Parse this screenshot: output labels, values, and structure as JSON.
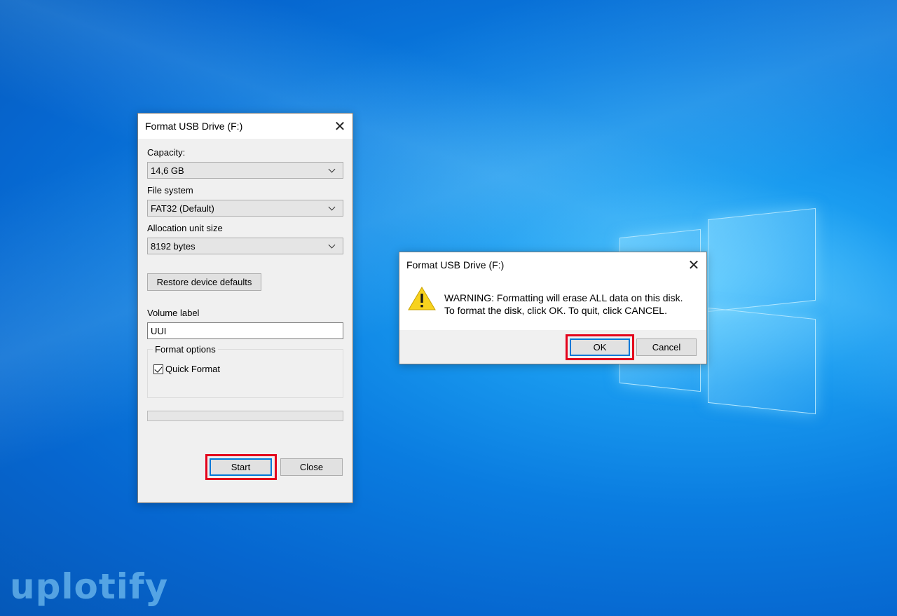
{
  "format_dialog": {
    "title": "Format USB Drive (F:)",
    "capacity_label": "Capacity:",
    "capacity_value": "14,6 GB",
    "filesystem_label": "File system",
    "filesystem_value": "FAT32 (Default)",
    "allocation_label": "Allocation unit size",
    "allocation_value": "8192 bytes",
    "restore_label": "Restore device defaults",
    "volume_label_label": "Volume label",
    "volume_label_value": "UUI",
    "format_options_label": "Format options",
    "quick_format_label": "Quick Format",
    "quick_format_checked": true,
    "progress": 0,
    "start_label": "Start",
    "close_label": "Close"
  },
  "warning_dialog": {
    "title": "Format USB Drive (F:)",
    "message_line1": "WARNING: Formatting will erase ALL data on this disk.",
    "message_line2": "To format the disk, click OK. To quit, click CANCEL.",
    "ok_label": "OK",
    "cancel_label": "Cancel"
  },
  "watermark": "uplotify",
  "icons": {
    "close": "close-icon",
    "dropdown": "chevron-down-icon",
    "warning": "warning-icon",
    "checkbox": "checkbox-checked-icon"
  },
  "colors": {
    "highlight": "#e3001b",
    "default_button_border": "#0078d7",
    "warning_yellow": "#f7d21e"
  }
}
